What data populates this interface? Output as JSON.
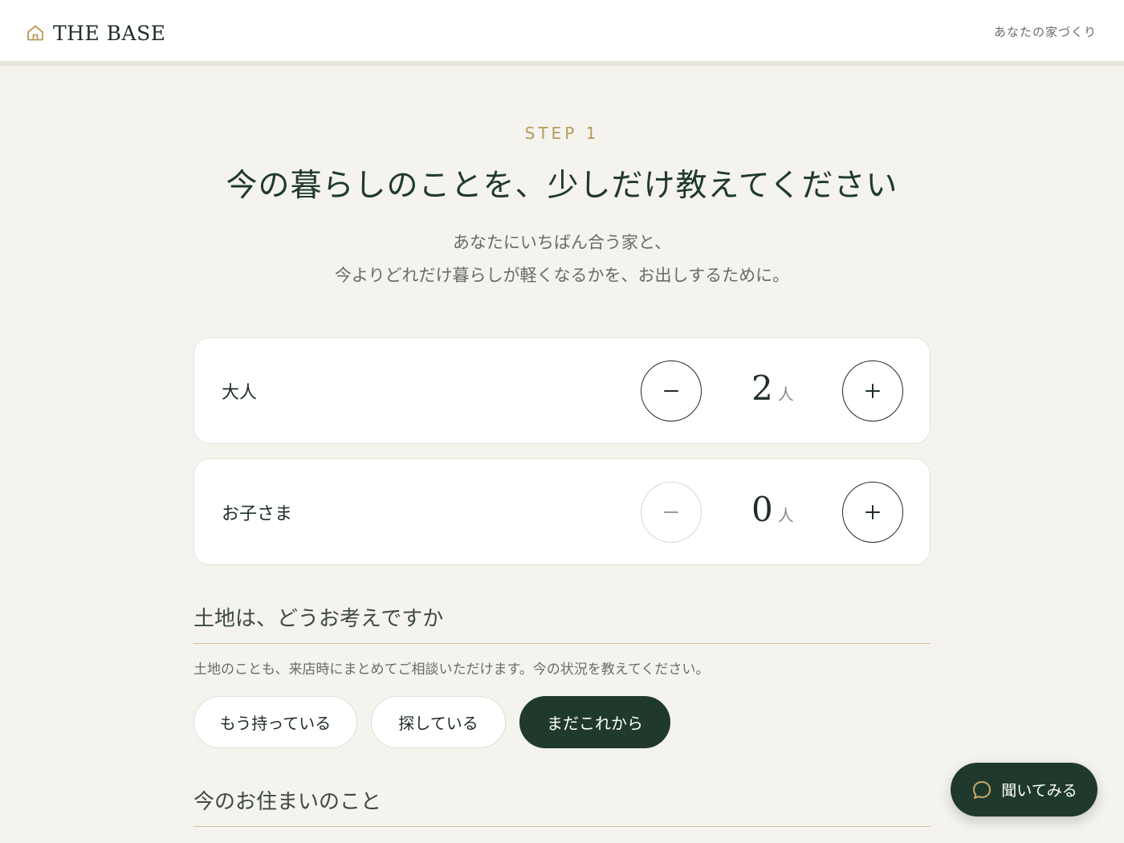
{
  "header": {
    "brand": "THE BASE",
    "brand_icon": "home-icon",
    "nav_link": "あなたの家づくり"
  },
  "intro": {
    "step": "STEP 1",
    "title": "今の暮らしのことを、少しだけ教えてください",
    "subtitle_line1": "あなたにいちばん合う家と、",
    "subtitle_line2": "今よりどれだけ暮らしが軽くなるかを、お出しするために。"
  },
  "household": [
    {
      "label": "大人",
      "count": "2",
      "unit": "人",
      "minus_icon": "minus-icon",
      "plus_icon": "plus-icon",
      "minus_enabled": true
    },
    {
      "label": "お子さま",
      "count": "0",
      "unit": "人",
      "minus_icon": "minus-icon",
      "plus_icon": "plus-icon",
      "minus_enabled": false
    }
  ],
  "land": {
    "title": "土地は、どうお考えですか",
    "description": "土地のことも、来店時にまとめてご相談いただけます。今の状況を教えてください。",
    "options": [
      "もう持っている",
      "探している",
      "まだこれから"
    ],
    "selected": "まだこれから"
  },
  "residence": {
    "title": "今のお住まいのこと"
  },
  "help_button": {
    "label": "聞いてみる",
    "icon": "chat-bubble-icon"
  },
  "colors": {
    "accent_gold": "#b9995a",
    "primary_green": "#1f3a2c",
    "background": "#f5f3ee"
  }
}
